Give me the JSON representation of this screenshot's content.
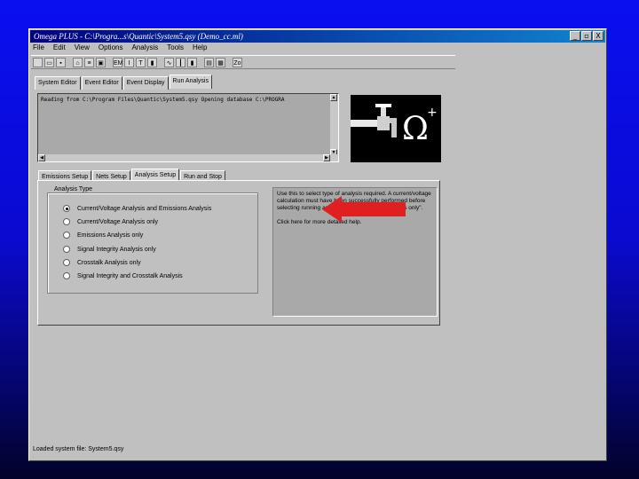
{
  "window": {
    "title": "Omega PLUS - C:\\Progra...s\\Quantic\\System5.qsy (Demo_cc.ml)",
    "buttons": [
      "_",
      "▫",
      "X"
    ]
  },
  "menu": [
    "File",
    "Edit",
    "View",
    "Options",
    "Analysis",
    "Tools",
    "Help"
  ],
  "toolbar": {
    "buttons": [
      {
        "icon": "new-file-icon",
        "glyph": ""
      },
      {
        "icon": "open-folder-icon",
        "glyph": "▭"
      },
      {
        "icon": "save-icon",
        "glyph": "▪"
      },
      {
        "icon": "faucet-icon",
        "glyph": "⌂"
      },
      {
        "icon": "chart-icon",
        "glyph": "≡"
      },
      {
        "icon": "trash-icon",
        "glyph": "▣"
      },
      {
        "icon": "em-icon",
        "glyph": "EM"
      },
      {
        "icon": "i-icon",
        "glyph": "I"
      },
      {
        "icon": "t-icon",
        "glyph": "T"
      },
      {
        "icon": "bars-icon",
        "glyph": "▮"
      },
      {
        "icon": "wave-icon",
        "glyph": "∿"
      },
      {
        "icon": "meter-icon",
        "glyph": "┃"
      },
      {
        "icon": "gauge-icon",
        "glyph": "▮"
      },
      {
        "icon": "print-icon",
        "glyph": "▤"
      },
      {
        "icon": "preview-icon",
        "glyph": "▦"
      },
      {
        "icon": "zoom-icon",
        "glyph": "Zo"
      }
    ]
  },
  "top_tabs": [
    "System Editor",
    "Event Editor",
    "Event Display",
    "Run Analysis"
  ],
  "console": {
    "text": "Reading from C:\\Program Files\\Quantic\\System5.qsy Opening database C:\\PROGRA"
  },
  "sub_tabs": [
    "Emissions Setup",
    "Nets Setup",
    "Analysis Setup",
    "Run and Stop"
  ],
  "analysis": {
    "group_title": "Analysis Type",
    "options": [
      {
        "label": "Current/Voltage Analysis and Emissions Analysis",
        "selected": true
      },
      {
        "label": "Current/Voltage Analysis only",
        "selected": false
      },
      {
        "label": "Emissions Analysis only",
        "selected": false
      },
      {
        "label": "Signal Integrity Analysis only",
        "selected": false
      },
      {
        "label": "Crosstalk Analysis only",
        "selected": false
      },
      {
        "label": "Signal Integrity and Crosstalk Analysis",
        "selected": false
      }
    ]
  },
  "help": {
    "text": "Use this to select type of analysis required. A current/voltage calculation must have been successfully performed before selecting running an analysis of type \"Run Analysis only\".",
    "more": "Click here for more detailed help."
  },
  "status": "Loaded system file: System5.qsy",
  "colors": {
    "arrow": "#e02020",
    "logo_bg": "#000000"
  }
}
